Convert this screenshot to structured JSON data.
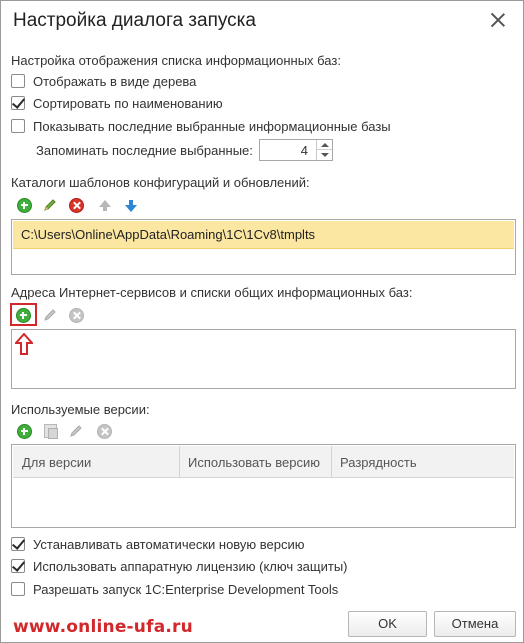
{
  "dialog": {
    "title": "Настройка диалога запуска"
  },
  "display_section": {
    "heading": "Настройка отображения списка информационных баз:",
    "options": [
      {
        "label": "Отображать в виде дерева",
        "checked": false
      },
      {
        "label": "Сортировать по наименованию",
        "checked": true
      },
      {
        "label": "Показывать последние выбранные информационные базы",
        "checked": false
      }
    ],
    "remember": {
      "label": "Запоминать последние выбранные:",
      "value": "4"
    }
  },
  "templates_section": {
    "heading": "Каталоги шаблонов конфигураций и обновлений:",
    "toolbar": [
      "add-icon",
      "edit-icon",
      "delete-icon",
      "move-up-icon",
      "move-down-icon"
    ],
    "items": [
      "C:\\Users\\Online\\AppData\\Roaming\\1C\\1Cv8\\tmplts"
    ]
  },
  "services_section": {
    "heading": "Адреса Интернет-сервисов и списки общих информационных баз:",
    "toolbar": [
      "add-icon",
      "edit-icon",
      "delete-icon"
    ]
  },
  "versions_section": {
    "heading": "Используемые версии:",
    "toolbar": [
      "add-icon",
      "copy-icon",
      "edit-icon",
      "delete-icon"
    ],
    "columns": [
      "Для версии",
      "Использовать версию",
      "Разрядность"
    ]
  },
  "bottom_options": [
    {
      "label": "Устанавливать автоматически новую версию",
      "checked": true
    },
    {
      "label": "Использовать аппаратную лицензию (ключ защиты)",
      "checked": true
    },
    {
      "label": "Разрешать запуск 1C:Enterprise Development Tools",
      "checked": false
    }
  ],
  "buttons": {
    "ok": "OK",
    "cancel": "Отмена"
  },
  "watermark": "www.online-ufa.ru",
  "colors": {
    "selected_row": "#fbe7a1",
    "highlight": "#d3282b",
    "add_green": "#3fae3a",
    "delete_red": "#d9342b",
    "arrow_blue": "#2e86d6"
  }
}
